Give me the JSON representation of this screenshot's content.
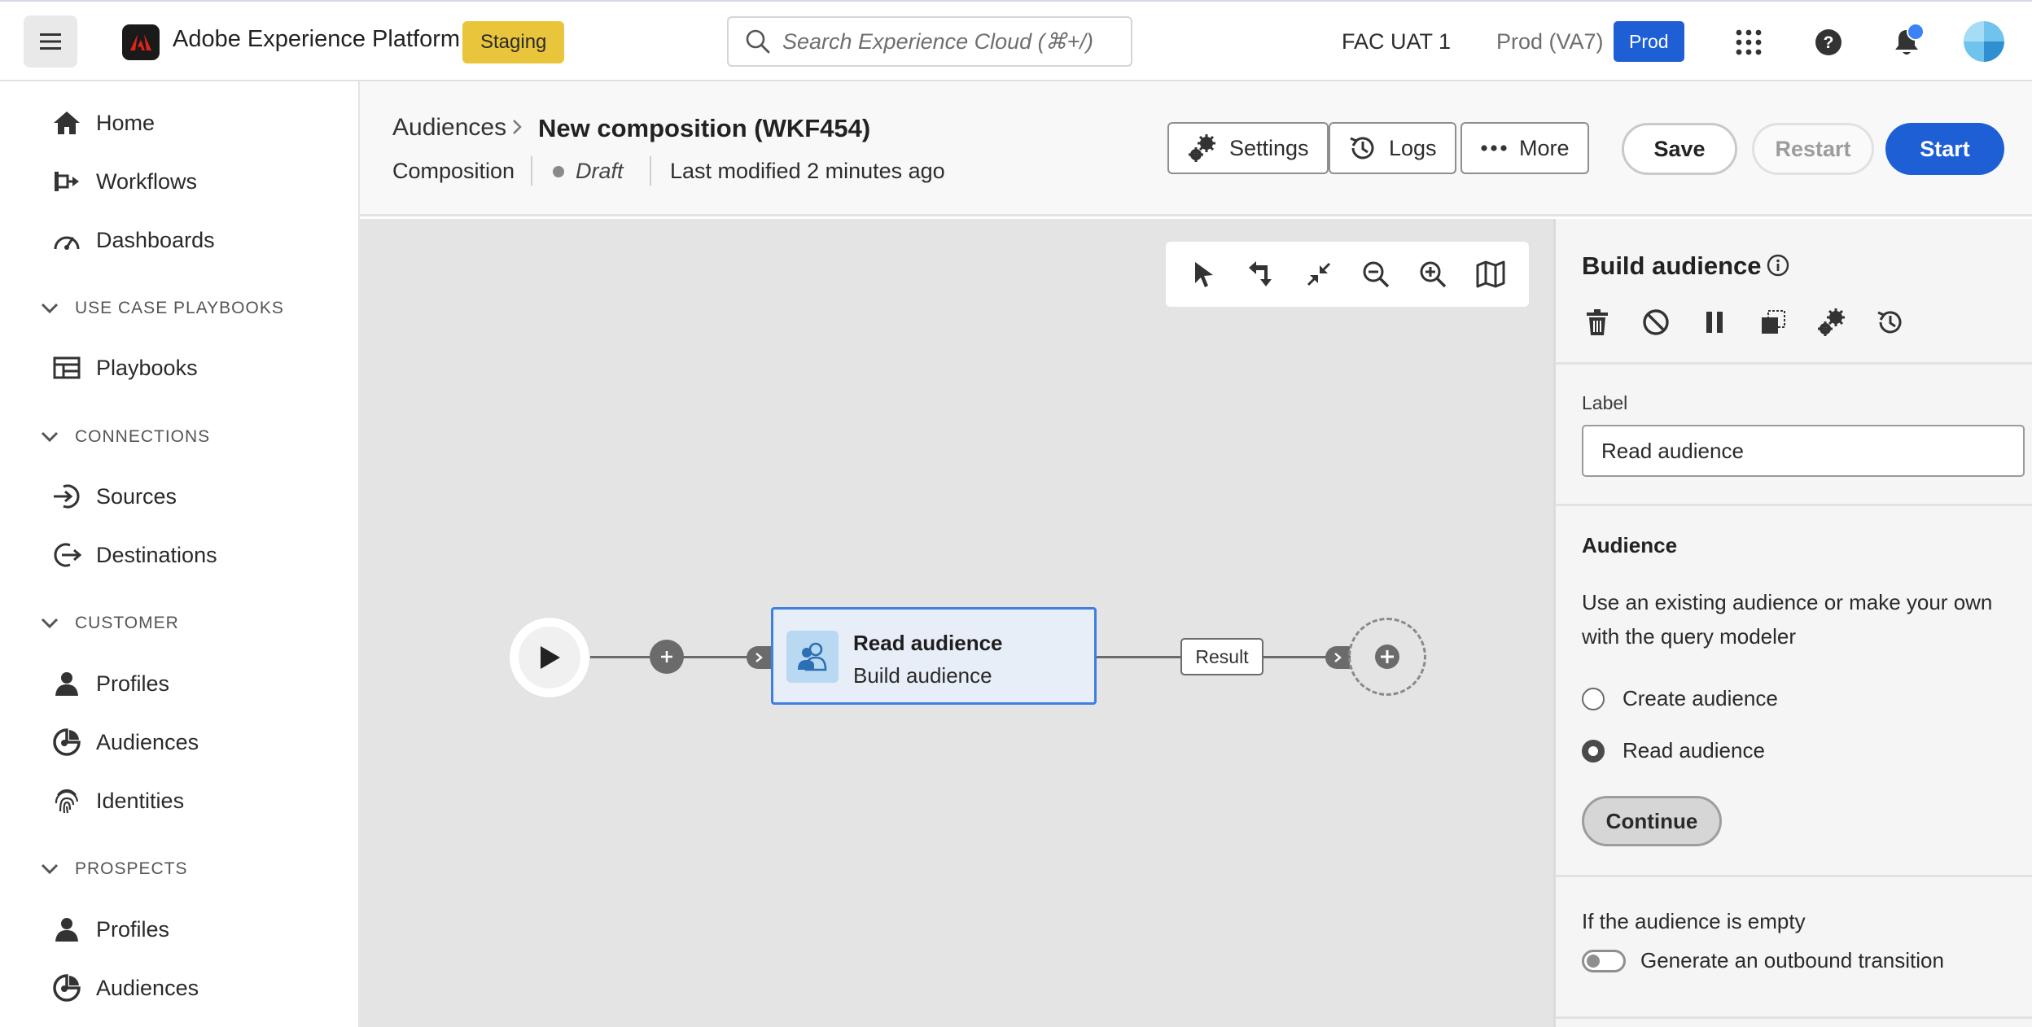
{
  "app": {
    "title": "Adobe Experience Platform",
    "environment_badge": "Staging",
    "search_placeholder": "Search Experience Cloud (⌘+/)",
    "org": "FAC UAT 1",
    "sandbox": "Prod (VA7)",
    "sandbox_badge": "Prod",
    "icons": [
      "menu-icon",
      "adobe-logo-icon",
      "search-icon",
      "apps-grid-icon",
      "help-icon",
      "bell-icon",
      "avatar"
    ],
    "accent_color": "#1f5fd6",
    "staging_color": "#e8c53a"
  },
  "sidebar": {
    "items_top": [
      {
        "label": "Home",
        "icon": "home-icon"
      },
      {
        "label": "Workflows",
        "icon": "workflow-icon"
      },
      {
        "label": "Dashboards",
        "icon": "dashboard-icon"
      }
    ],
    "sections": [
      {
        "label": "USE CASE PLAYBOOKS",
        "items": [
          {
            "label": "Playbooks",
            "icon": "playbook-icon"
          }
        ]
      },
      {
        "label": "CONNECTIONS",
        "items": [
          {
            "label": "Sources",
            "icon": "sources-icon"
          },
          {
            "label": "Destinations",
            "icon": "destinations-icon"
          }
        ]
      },
      {
        "label": "CUSTOMER",
        "items": [
          {
            "label": "Profiles",
            "icon": "profile-icon"
          },
          {
            "label": "Audiences",
            "icon": "audience-icon"
          },
          {
            "label": "Identities",
            "icon": "fingerprint-icon"
          }
        ]
      },
      {
        "label": "PROSPECTS",
        "items": [
          {
            "label": "Profiles",
            "icon": "profile-icon"
          },
          {
            "label": "Audiences",
            "icon": "audience-icon"
          }
        ]
      }
    ]
  },
  "header": {
    "breadcrumb_parent": "Audiences",
    "breadcrumb_current": "New composition (WKF454)",
    "type": "Composition",
    "status": "Draft",
    "last_modified": "Last modified 2 minutes ago",
    "buttons": {
      "settings": "Settings",
      "logs": "Logs",
      "more": "More",
      "save": "Save",
      "restart": "Restart",
      "start": "Start"
    }
  },
  "canvas": {
    "toolbar_icons": [
      "select-pointer-icon",
      "swap-arrows-icon",
      "collapse-icon",
      "zoom-out-icon",
      "zoom-in-icon",
      "map-icon"
    ],
    "activity": {
      "title": "Read audience",
      "subtitle": "Build audience"
    },
    "transition_label": "Result"
  },
  "panel": {
    "title": "Build audience",
    "tool_icons": [
      "delete-icon",
      "disable-icon",
      "pause-icon",
      "copy-icon",
      "settings-icon",
      "history-icon"
    ],
    "label_field_label": "Label",
    "label_field_value": "Read audience",
    "audience_heading": "Audience",
    "audience_description": "Use an existing audience or make your own with the query modeler",
    "options": [
      {
        "label": "Create audience",
        "checked": false
      },
      {
        "label": "Read audience",
        "checked": true
      }
    ],
    "continue_label": "Continue",
    "empty_label": "If the audience is empty",
    "toggle_label": "Generate an outbound transition",
    "toggle_on": false
  }
}
